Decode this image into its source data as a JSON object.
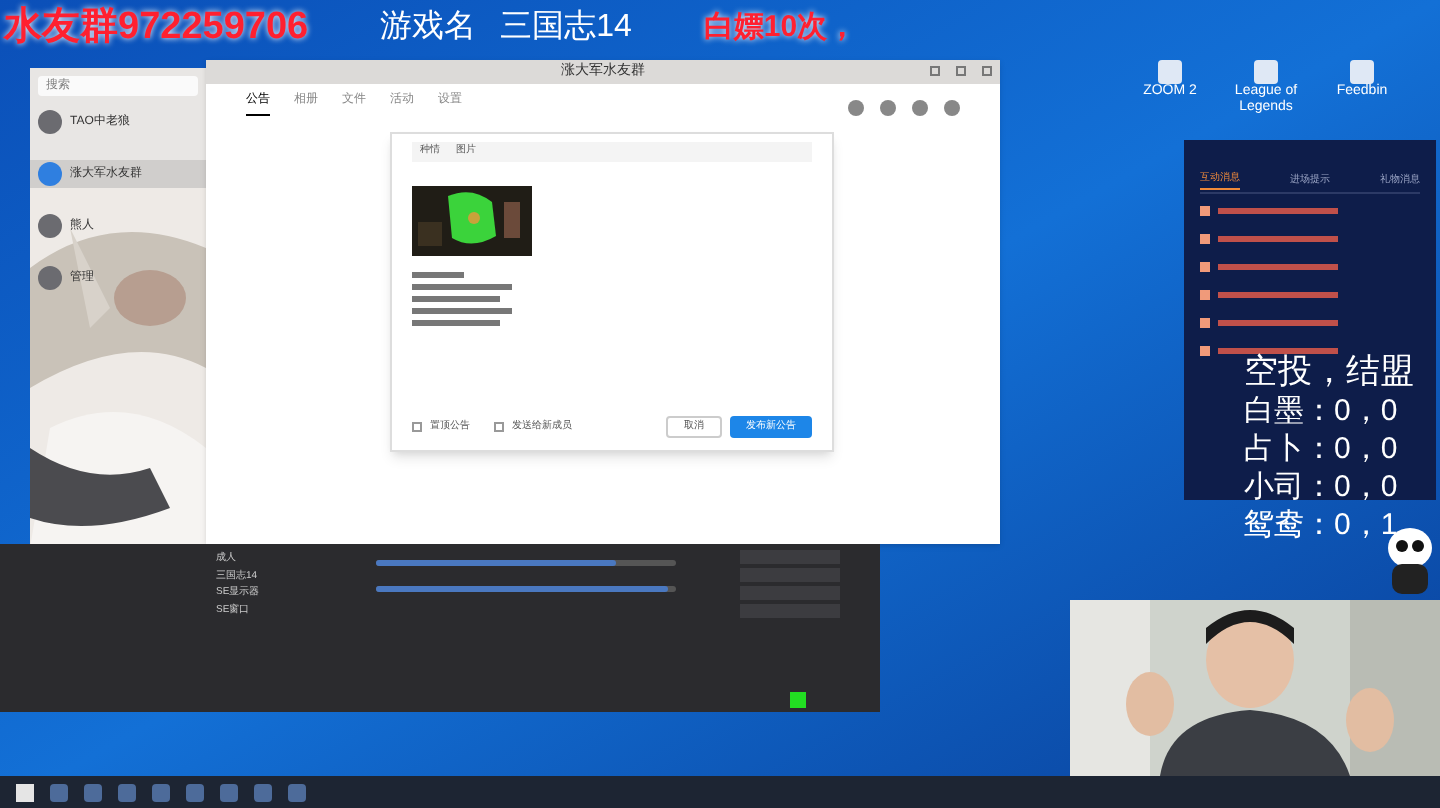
{
  "overlay_top": {
    "group": "水友群972259706",
    "game_label": "游戏名",
    "game": "三国志14",
    "note": "白嫖10次，"
  },
  "desktop_icons": [
    {
      "label": "ZOOM 2"
    },
    {
      "label": "League of Legends"
    },
    {
      "label": "Feedbin"
    }
  ],
  "chat_list": {
    "search": {
      "placeholder": "搜索"
    },
    "items": [
      {
        "name": "TAO中老狼",
        "selected": false
      },
      {
        "name": "涨大军水友群",
        "selected": true
      },
      {
        "name": "熊人",
        "selected": false
      },
      {
        "name": "管理",
        "selected": false
      }
    ]
  },
  "group_window": {
    "title": "涨大军水友群",
    "tabs": [
      {
        "label": "公告",
        "selected": true
      },
      {
        "label": "相册",
        "selected": false
      },
      {
        "label": "文件",
        "selected": false
      },
      {
        "label": "活动",
        "selected": false
      },
      {
        "label": "设置",
        "selected": false
      }
    ]
  },
  "announcement_editor": {
    "toolbar": [
      "种情",
      "图片"
    ],
    "options": [
      {
        "label": "置顶公告",
        "checked": false
      },
      {
        "label": "发送给新成员",
        "checked": false
      }
    ],
    "buttons": [
      {
        "label": "取消",
        "kind": "secondary"
      },
      {
        "label": "发布新公告",
        "kind": "primary"
      }
    ]
  },
  "volumes": [
    {
      "level": 0.8
    },
    {
      "level": 0.97
    }
  ],
  "obs": {
    "sources": [
      "成人",
      "三国志14",
      "SE显示器",
      "SE窗口"
    ]
  },
  "live_chat": {
    "tabs": [
      {
        "label": "互动消息",
        "selected": true
      },
      {
        "label": "进场提示",
        "selected": false
      },
      {
        "label": "礼物消息",
        "selected": false
      }
    ]
  },
  "overlay_right": {
    "title": "空投，结盟",
    "rows": [
      "白墨：0，0",
      "占卜：0，0",
      "小司：0，0",
      "鸳鸯：0，1"
    ]
  }
}
